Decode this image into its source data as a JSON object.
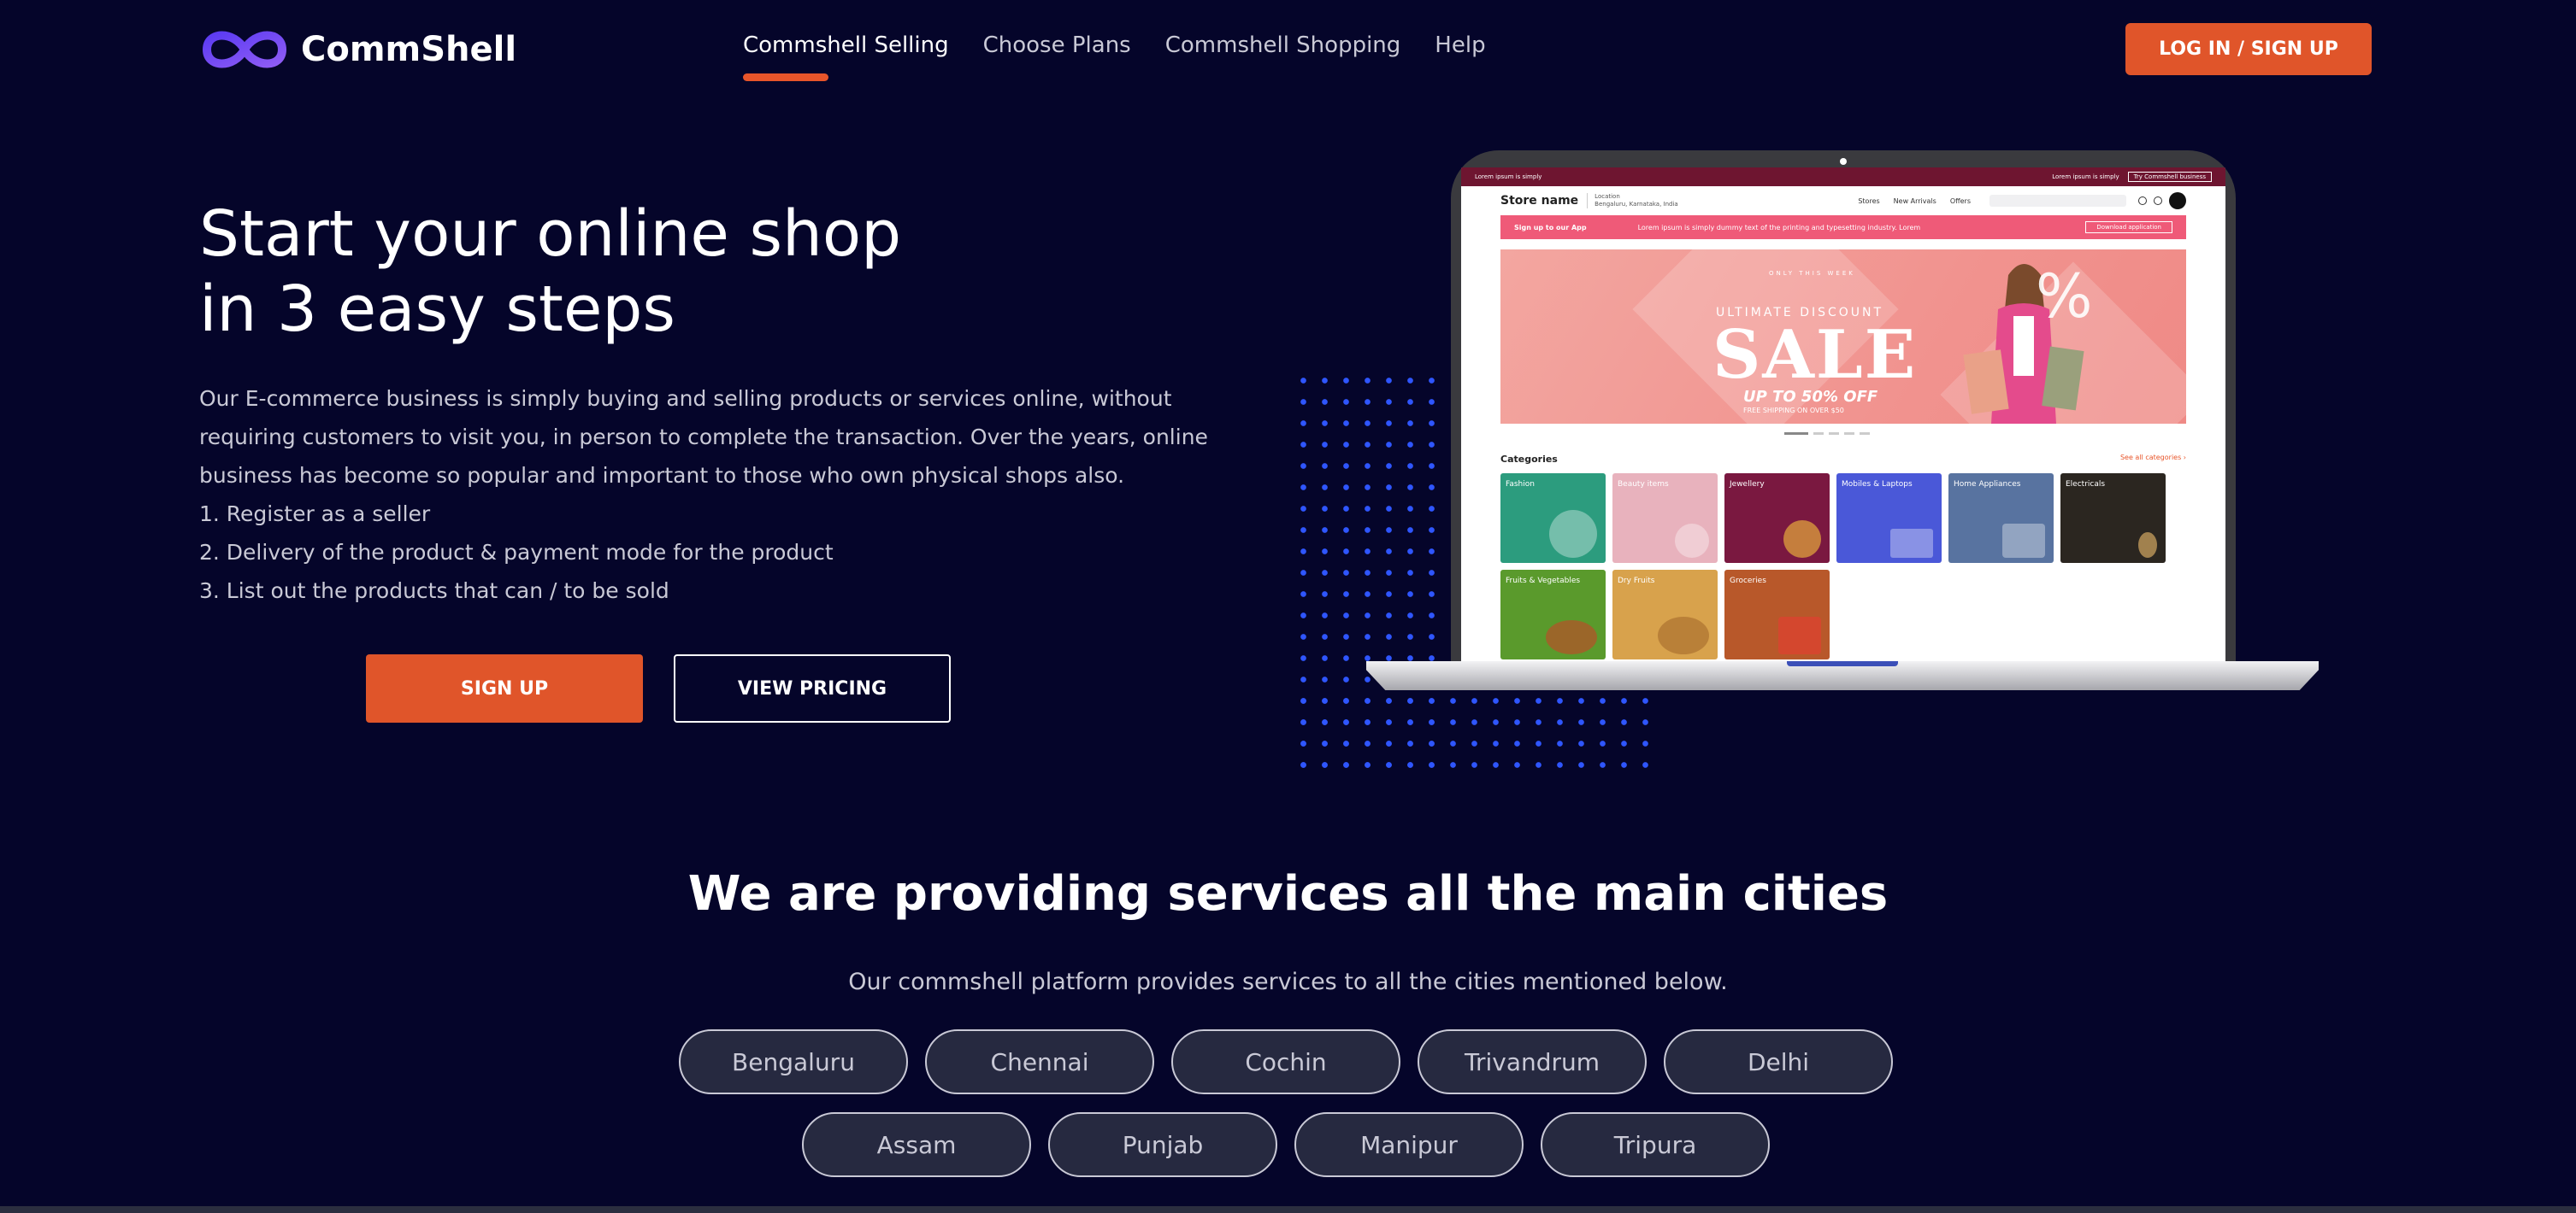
{
  "brand": {
    "name": "CommShell",
    "logo_icon": "infinity-logo-icon",
    "accent": "#e0552a",
    "background": "#05052a",
    "dot_color": "#2f56ff"
  },
  "nav": {
    "items": [
      {
        "label": "Commshell Selling",
        "active": true
      },
      {
        "label": "Choose Plans",
        "active": false
      },
      {
        "label": "Commshell Shopping",
        "active": false
      },
      {
        "label": "Help",
        "active": false
      }
    ]
  },
  "header": {
    "login_label": "LOG IN / SIGN UP"
  },
  "hero": {
    "title_line1": "Start your online shop",
    "title_line2": "in 3 easy steps",
    "description": [
      "Our E-commerce business is simply buying and selling products or services online, without",
      "requiring customers to visit you, in person to complete the transaction. Over the years, online",
      "business has become so popular and important to those who own physical shops also."
    ],
    "steps": [
      "1. Register as a seller",
      "2. Delivery of the product & payment mode for the product",
      "3. List out the products that can / to be sold"
    ],
    "signup_label": "SIGN UP",
    "pricing_label": "VIEW PRICING"
  },
  "preview": {
    "top_left": "Lorem ipsum is simply",
    "top_right": "Lorem ipsum is simply",
    "top_button": "Try Commshell business",
    "store_name": "Store name",
    "location_label": "Location",
    "location_value": "Bengaluru, Karnataka, India",
    "menu": [
      "Stores",
      "New Arrivals",
      "Offers"
    ],
    "banner_left": "Sign up to our App",
    "banner_text": "Lorem ipsum is simply dummy text of the printing and typesetting industry. Lorem",
    "banner_button": "Download application",
    "hero_week": "ONLY THIS WEEK",
    "hero_discount": "ULTIMATE DISCOUNT",
    "hero_sale": "SALE",
    "hero_off": "UP TO 50% OFF",
    "hero_shipping": "FREE SHIPPING ON OVER $50",
    "hero_percent": "%",
    "categories_title": "Categories",
    "categories_link": "See all categories ›",
    "categories": [
      {
        "label": "Fashion",
        "color": "#2c9c7e"
      },
      {
        "label": "Beauty items",
        "color": "#e8b2bd"
      },
      {
        "label": "Jewellery",
        "color": "#7a1840"
      },
      {
        "label": "Mobiles & Laptops",
        "color": "#4a58d8"
      },
      {
        "label": "Home Appliances",
        "color": "#5873a0"
      },
      {
        "label": "Electricals",
        "color": "#2b2620"
      },
      {
        "label": "Fruits & Vegetables",
        "color": "#5a9a2c"
      },
      {
        "label": "Dry Fruits",
        "color": "#d8a24c"
      },
      {
        "label": "Groceries",
        "color": "#b8582a"
      }
    ]
  },
  "cities": {
    "title": "We are providing services all the main cities",
    "subtitle": "Our commshell platform provides services to all the cities mentioned below.",
    "items": [
      "Bengaluru",
      "Chennai",
      "Cochin",
      "Trivandrum",
      "Delhi",
      "Assam",
      "Punjab",
      "Manipur",
      "Tripura"
    ]
  }
}
